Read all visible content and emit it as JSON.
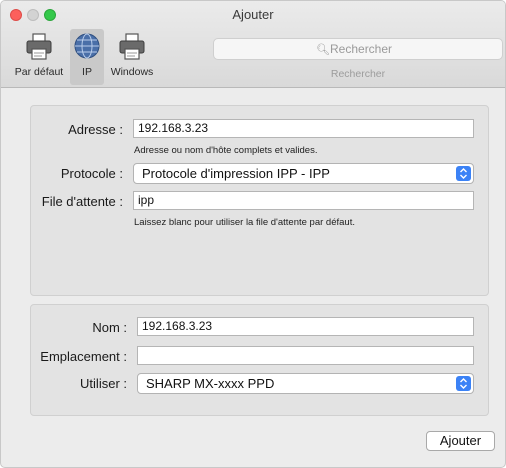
{
  "window": {
    "title": "Ajouter"
  },
  "toolbar": {
    "tools": [
      {
        "label": "Par défaut",
        "icon": "printer-icon",
        "selected": false
      },
      {
        "label": "IP",
        "icon": "globe-icon",
        "selected": true
      },
      {
        "label": "Windows",
        "icon": "printer-icon",
        "selected": false
      }
    ],
    "search": {
      "placeholder": "Rechercher",
      "caption": "Rechercher"
    }
  },
  "form": {
    "address": {
      "label": "Adresse :",
      "value": "192.168.3.23",
      "hint": "Adresse ou nom d'hôte complets et valides."
    },
    "protocol": {
      "label": "Protocole :",
      "value": "Protocole d'impression IPP - IPP"
    },
    "queue": {
      "label": "File d'attente :",
      "value": "ipp",
      "hint": "Laissez blanc pour utiliser la file d'attente par défaut."
    },
    "name": {
      "label": "Nom :",
      "value": "192.168.3.23"
    },
    "location": {
      "label": "Emplacement :",
      "value": ""
    },
    "use": {
      "label": "Utiliser :",
      "value": "SHARP MX-xxxx PPD"
    }
  },
  "footer": {
    "add_label": "Ajouter"
  },
  "colors": {
    "accent": "#3b82f6",
    "close": "#fc605c",
    "zoom": "#34c84a"
  }
}
